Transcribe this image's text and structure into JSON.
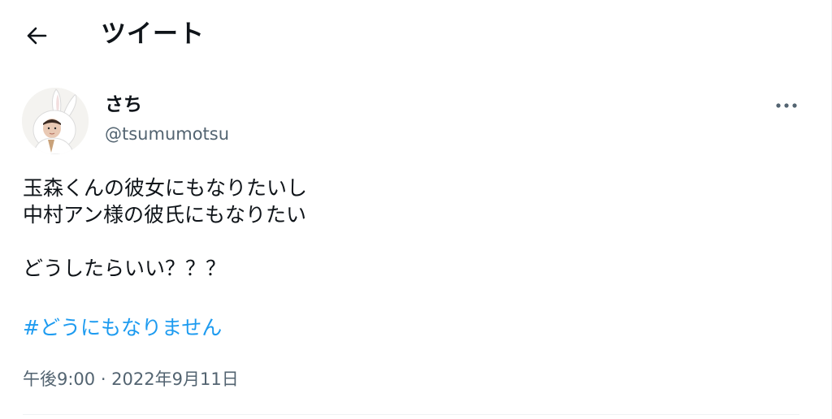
{
  "header": {
    "title": "ツイート"
  },
  "tweet": {
    "author": {
      "name": "さち",
      "handle": "@tsumumotsu"
    },
    "text_lines": [
      "玉森くんの彼女にもなりたいし",
      "中村アン様の彼氏にもなりたい",
      "",
      "どうしたらいい？？？"
    ],
    "hashtag": "#どうにもなりません",
    "timestamp": "午後9:00 · 2022年9月11日"
  },
  "colors": {
    "link": "#1d9bf0",
    "secondary_text": "#536471",
    "primary_text": "#0f1419"
  },
  "icons": {
    "back": "arrow-left-icon",
    "more": "more-horizontal-icon"
  }
}
